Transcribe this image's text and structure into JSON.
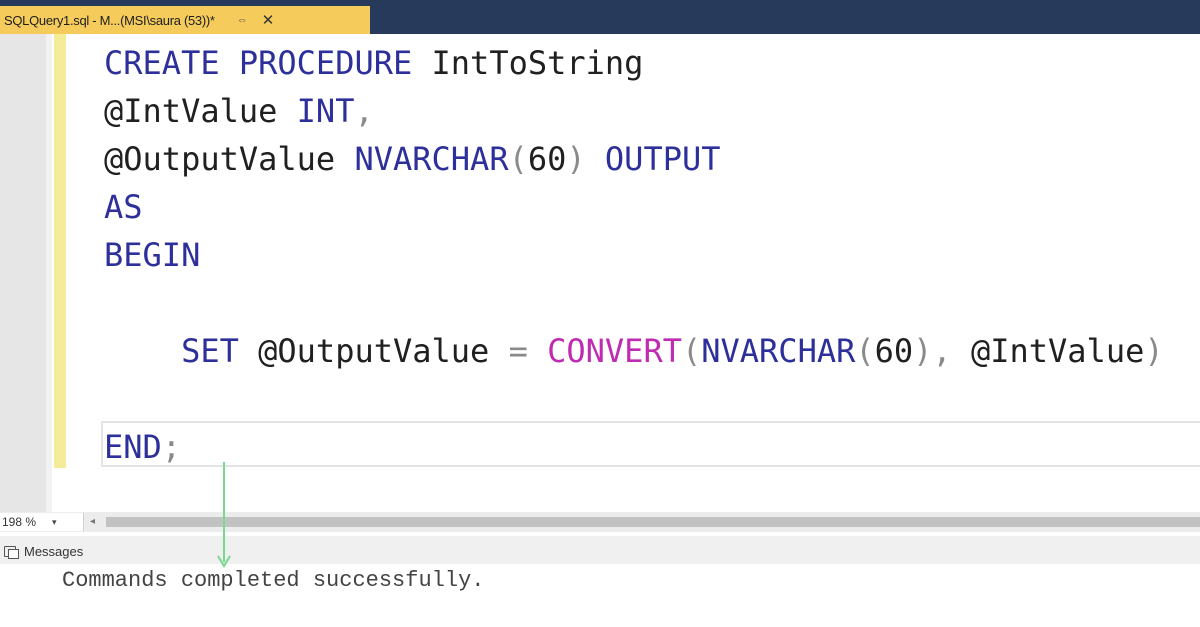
{
  "tab": {
    "title": "SQLQuery1.sql - M...(MSI\\saura (53))*",
    "pin_glyph": "⇔",
    "close_glyph": "✕"
  },
  "editor": {
    "lines": [
      [
        {
          "t": "CREATE PROCEDURE ",
          "c": "kw"
        },
        {
          "t": "IntToString",
          "c": "txt"
        }
      ],
      [
        {
          "t": "@IntValue ",
          "c": "txt"
        },
        {
          "t": "INT",
          "c": "kw"
        },
        {
          "t": ",",
          "c": "op"
        }
      ],
      [
        {
          "t": "@OutputValue ",
          "c": "txt"
        },
        {
          "t": "NVARCHAR",
          "c": "kw"
        },
        {
          "t": "(",
          "c": "op"
        },
        {
          "t": "60",
          "c": "txt"
        },
        {
          "t": ") ",
          "c": "op"
        },
        {
          "t": "OUTPUT",
          "c": "kw"
        }
      ],
      [
        {
          "t": "AS",
          "c": "kw"
        }
      ],
      [
        {
          "t": "BEGIN",
          "c": "kw"
        }
      ],
      [],
      [
        {
          "t": "    SET ",
          "c": "kw"
        },
        {
          "t": "@OutputValue ",
          "c": "txt"
        },
        {
          "t": "= ",
          "c": "op"
        },
        {
          "t": "CONVERT",
          "c": "fn"
        },
        {
          "t": "(",
          "c": "op"
        },
        {
          "t": "NVARCHAR",
          "c": "kw"
        },
        {
          "t": "(",
          "c": "op"
        },
        {
          "t": "60",
          "c": "txt"
        },
        {
          "t": "), ",
          "c": "op"
        },
        {
          "t": "@IntValue",
          "c": "txt"
        },
        {
          "t": ")",
          "c": "op"
        }
      ],
      [],
      [
        {
          "t": "END",
          "c": "kw"
        },
        {
          "t": ";",
          "c": "op"
        }
      ]
    ]
  },
  "zoom": {
    "value": "198 %",
    "dropdown_glyph": "▾"
  },
  "scrollbar": {
    "left_arrow": "◂"
  },
  "results": {
    "tab_label": "Messages",
    "message": "Commands completed successfully."
  },
  "colors": {
    "keyword": "#2d2f9a",
    "function": "#bf2bb1",
    "operator": "#8a8a8a",
    "tab_active": "#f5cc5b",
    "tab_strip": "#283a5b",
    "change_bar": "#f5ec9a",
    "arrow": "#7bd88f"
  },
  "icons": {
    "messages_tab": "messages-icon",
    "annotation": "down-arrow-annotation"
  }
}
